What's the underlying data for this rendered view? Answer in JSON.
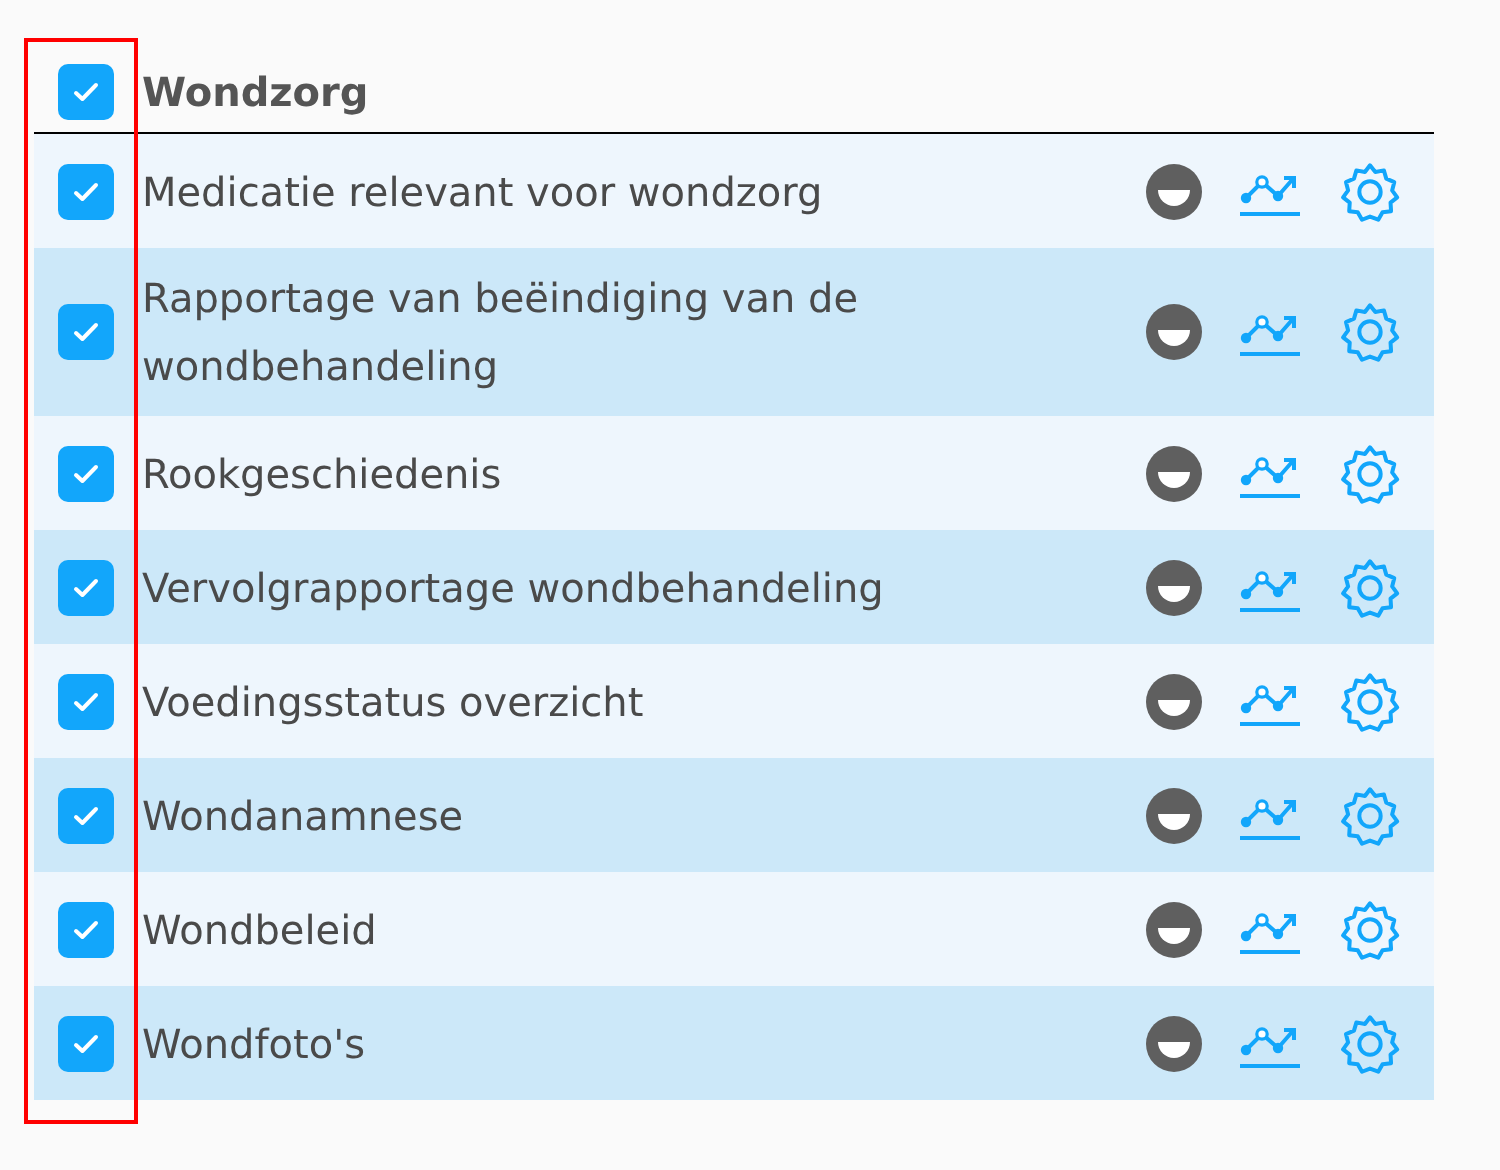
{
  "group": {
    "title": "Wondzorg",
    "checked": true
  },
  "rows": [
    {
      "label": "Medicatie relevant voor wondzorg",
      "checked": true
    },
    {
      "label": "Rapportage van beëindiging van de wondbehandeling",
      "checked": true
    },
    {
      "label": "Rookgeschiedenis",
      "checked": true
    },
    {
      "label": "Vervolgrapportage wondbehandeling",
      "checked": true
    },
    {
      "label": "Voedingsstatus overzicht",
      "checked": true
    },
    {
      "label": "Wondanamnese",
      "checked": true
    },
    {
      "label": "Wondbeleid",
      "checked": true
    },
    {
      "label": "Wondfoto's",
      "checked": true
    }
  ]
}
